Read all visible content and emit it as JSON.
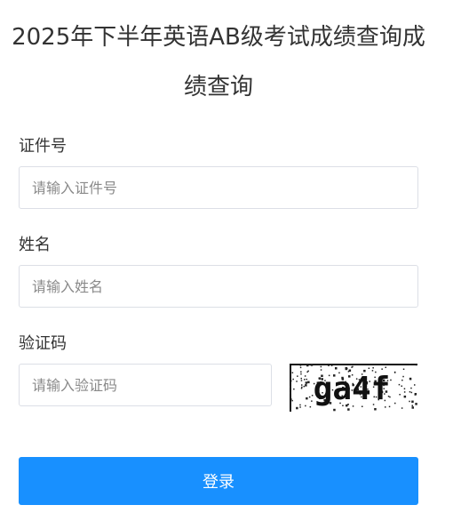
{
  "page": {
    "title_line1": "2025年下半年英语AB级考试成绩查询成",
    "title_line2": "绩查询"
  },
  "form": {
    "id_label": "证件号",
    "id_placeholder": "请输入证件号",
    "id_value": "",
    "name_label": "姓名",
    "name_placeholder": "请输入姓名",
    "name_value": "",
    "captcha_label": "验证码",
    "captcha_placeholder": "请输入验证码",
    "captcha_value": "",
    "captcha_text": "ga4f",
    "login_label": "登录"
  },
  "colors": {
    "primary": "#1890ff",
    "border": "#dcdfe6",
    "text": "#333333",
    "placeholder": "#8a8a8a"
  }
}
